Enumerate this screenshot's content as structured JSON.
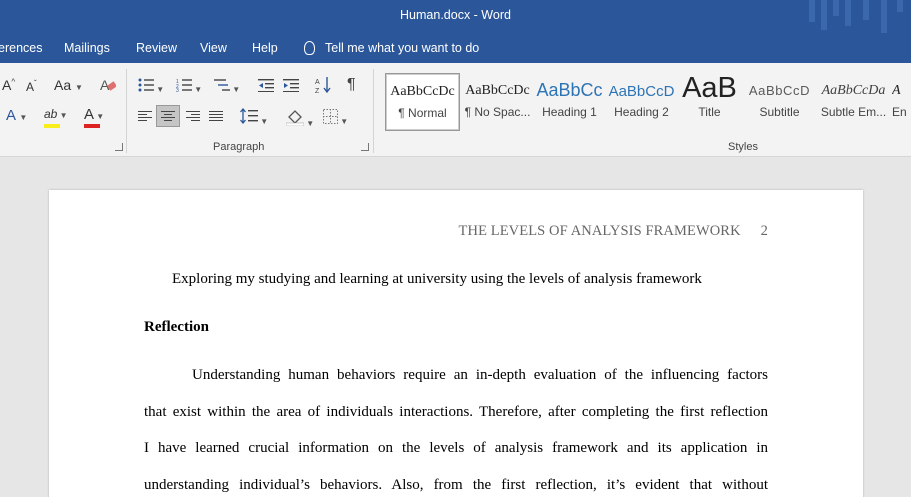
{
  "window": {
    "title": "Human.docx  -  Word"
  },
  "tabs": [
    "erences",
    "Mailings",
    "Review",
    "View",
    "Help"
  ],
  "tell_me": "Tell me what you want to do",
  "ribbon": {
    "font_group": {
      "grow_label": "A",
      "shrink_label": "A",
      "change_case_label": "Aa",
      "font_color_label": "A",
      "text_effects_label": "A",
      "highlight_label": "ab"
    },
    "paragraph_group": {
      "label": "Paragraph",
      "show_marks_glyph": "¶"
    },
    "styles_group": {
      "label": "Styles",
      "items": [
        {
          "sample": "AaBbCcDc",
          "name": "¶ Normal"
        },
        {
          "sample": "AaBbCcDc",
          "name": "¶ No Spac..."
        },
        {
          "sample": "AaBbCc",
          "name": "Heading 1"
        },
        {
          "sample": "AaBbCcD",
          "name": "Heading 2"
        },
        {
          "sample": "AaB",
          "name": "Title"
        },
        {
          "sample": "AaBbCcD",
          "name": "Subtitle"
        },
        {
          "sample": "AaBbCcDa",
          "name": "Subtle Em..."
        },
        {
          "sample": "A",
          "name": "En"
        }
      ]
    }
  },
  "document": {
    "running_head": "THE LEVELS OF ANALYSIS FRAMEWORK",
    "page_number": "2",
    "title": "Exploring my studying and learning at university using the levels of analysis framework",
    "heading": "Reflection",
    "paragraph_lines": [
      "Understanding human behaviors require an in-depth evaluation of the influencing factors",
      "that exist within the area of individuals interactions. Therefore, after completing the first reflection",
      "I have learned crucial information on the levels of analysis framework and its application in",
      "understanding individual’s behaviors. Also, from the first reflection, it’s evident that without"
    ]
  }
}
